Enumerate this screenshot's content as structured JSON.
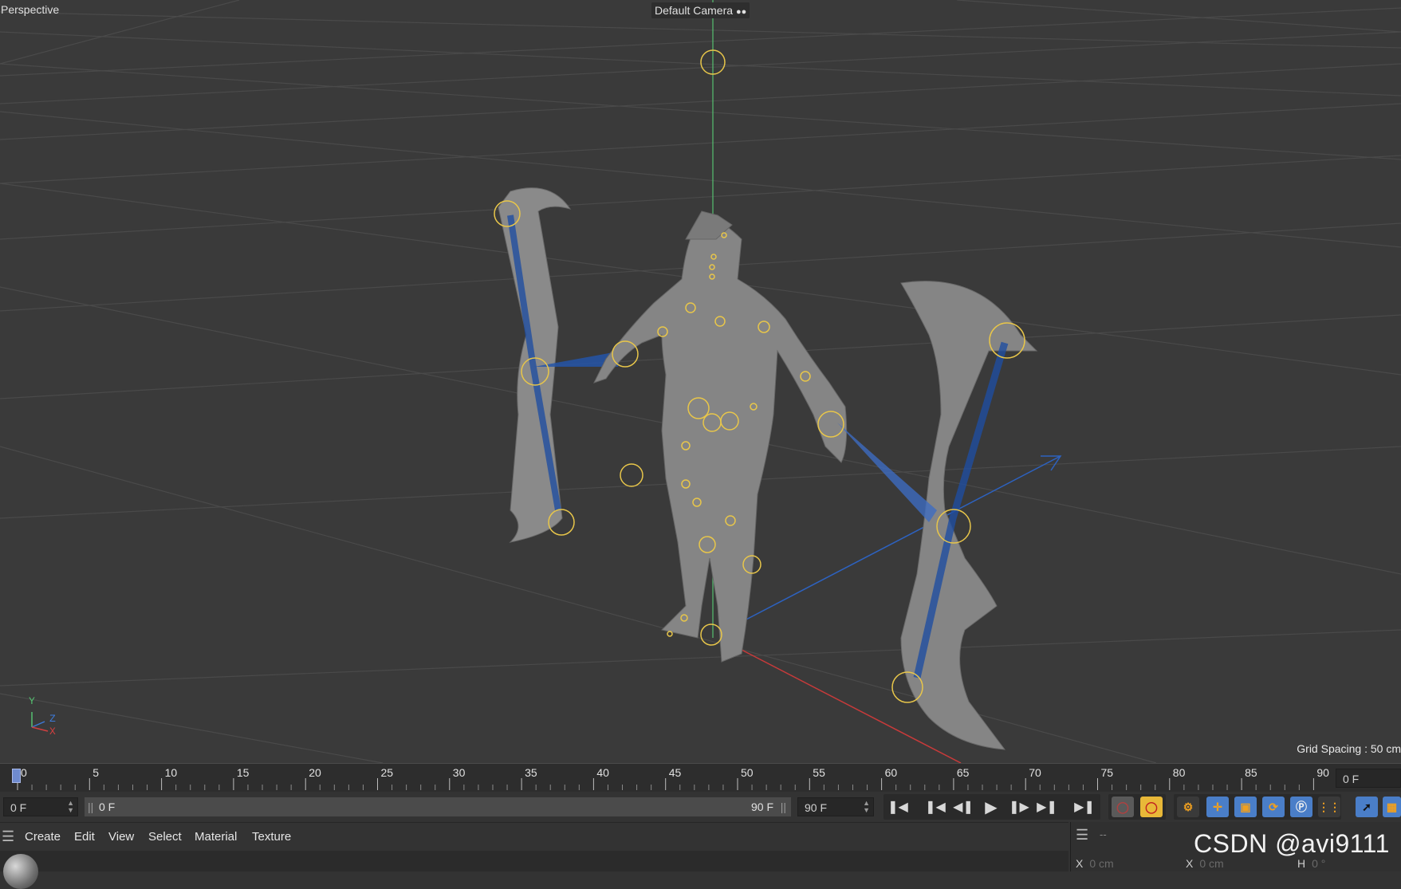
{
  "viewport": {
    "view_name": "Perspective",
    "camera_name": "Default Camera",
    "grid_spacing": "Grid Spacing : 50 cm",
    "axis_labels": {
      "y": "Y",
      "z": "Z",
      "x": "X"
    }
  },
  "timeline": {
    "ticks": [
      "0",
      "5",
      "10",
      "15",
      "20",
      "25",
      "30",
      "35",
      "40",
      "45",
      "50",
      "55",
      "60",
      "65",
      "70",
      "75",
      "80",
      "85",
      "90"
    ],
    "current_frame": "0 F"
  },
  "transport": {
    "current_frame_field": "0 F",
    "range_start": "0 F",
    "range_end": "90 F",
    "end_frame_field": "90 F"
  },
  "menu": {
    "items": [
      "Create",
      "Edit",
      "View",
      "Select",
      "Material",
      "Texture"
    ]
  },
  "coordinates": {
    "panel_title": "--",
    "pos_x_label": "X",
    "pos_x_value": "0 cm",
    "size_x_label": "X",
    "size_x_value": "0 cm",
    "rot_h_label": "H",
    "rot_h_value": "0 °"
  },
  "watermark": "CSDN @avi9111",
  "colors": {
    "viewport_bg": "#3a3a3a",
    "joint_ring": "#e8c64a",
    "bone_blue": "#2255a8",
    "accent_orange": "#f0a020",
    "accent_blue": "#4a90e2"
  }
}
